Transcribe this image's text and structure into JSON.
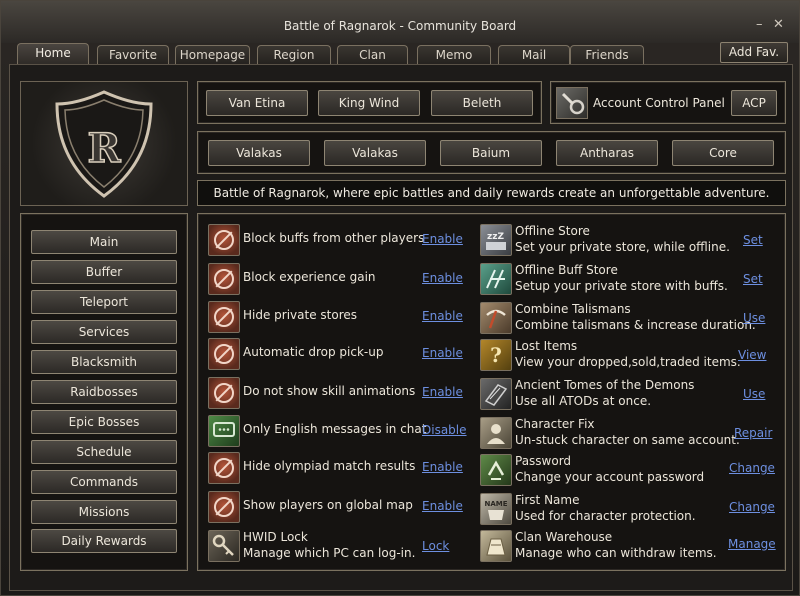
{
  "window": {
    "title": "Battle of Ragnarok - Community Board",
    "min_icon": "minimize-icon",
    "close_icon": "close-icon"
  },
  "tabs": [
    {
      "label": "Home",
      "active": true
    },
    {
      "label": "Favorite"
    },
    {
      "label": "Homepage"
    },
    {
      "label": "Region"
    },
    {
      "label": "Clan"
    },
    {
      "label": "Memo"
    },
    {
      "label": "Mail"
    },
    {
      "label": "Friends"
    }
  ],
  "add_fav": "Add Fav.",
  "logo": {
    "letter": "R"
  },
  "towns": [
    "Van Etina",
    "King Wind",
    "Beleth"
  ],
  "acp": {
    "label": "Account Control Panel",
    "button": "ACP",
    "icon": "wrench-gear-icon"
  },
  "bosses": [
    "Valakas",
    "Valakas",
    "Baium",
    "Antharas",
    "Core"
  ],
  "tagline": "Battle of Ragnarok, where epic battles and daily rewards create an unforgettable adventure.",
  "sidebar": [
    "Main",
    "Buffer",
    "Teleport",
    "Services",
    "Blacksmith",
    "Raidbosses",
    "Epic Bosses",
    "Schedule",
    "Commands",
    "Missions",
    "Daily Rewards"
  ],
  "left_options": [
    {
      "label": "Block buffs from other players",
      "action": "Enable",
      "icon": "block-icon"
    },
    {
      "label": "Block experience gain",
      "action": "Enable",
      "icon": "block-icon"
    },
    {
      "label": "Hide private stores",
      "action": "Enable",
      "icon": "block-icon"
    },
    {
      "label": "Automatic drop pick-up",
      "action": "Enable",
      "icon": "block-icon"
    },
    {
      "label": "Do not show skill animations",
      "action": "Enable",
      "icon": "block-icon"
    },
    {
      "label": "Only English messages in chat",
      "action": "Disable",
      "icon": "chat-icon"
    },
    {
      "label": "Hide olympiad match results",
      "action": "Enable",
      "icon": "block-icon"
    },
    {
      "label": "Show players on global map",
      "action": "Enable",
      "icon": "block-icon"
    },
    {
      "label": "HWID Lock",
      "desc": "Manage which PC can log-in.",
      "action": "Lock",
      "icon": "key-icon"
    }
  ],
  "right_options": [
    {
      "label": "Offline Store",
      "desc": "Set your private store, while offline.",
      "action": "Set",
      "icon": "sleep-store-icon"
    },
    {
      "label": "Offline Buff Store",
      "desc": "Setup your private store with buffs.",
      "action": "Set",
      "icon": "buff-store-icon"
    },
    {
      "label": "Combine Talismans",
      "desc": "Combine talismans & increase duration.",
      "action": "Use",
      "icon": "pickaxe-icon"
    },
    {
      "label": "Lost Items",
      "desc": "View your dropped,sold,traded items.",
      "action": "View",
      "icon": "question-icon"
    },
    {
      "label": "Ancient Tomes of the Demons",
      "desc": "Use all ATODs at once.",
      "action": "Use",
      "icon": "tome-icon"
    },
    {
      "label": "Character Fix",
      "desc": "Un-stuck character on same account.",
      "action": "Repair",
      "icon": "character-icon"
    },
    {
      "label": "Password",
      "desc": "Change your account password",
      "action": "Change",
      "icon": "password-icon"
    },
    {
      "label": "First Name",
      "desc": "Used for character protection.",
      "action": "Change",
      "icon": "name-tag-icon"
    },
    {
      "label": "Clan Warehouse",
      "desc": "Manage who can withdraw items.",
      "action": "Manage",
      "icon": "warehouse-icon"
    }
  ]
}
